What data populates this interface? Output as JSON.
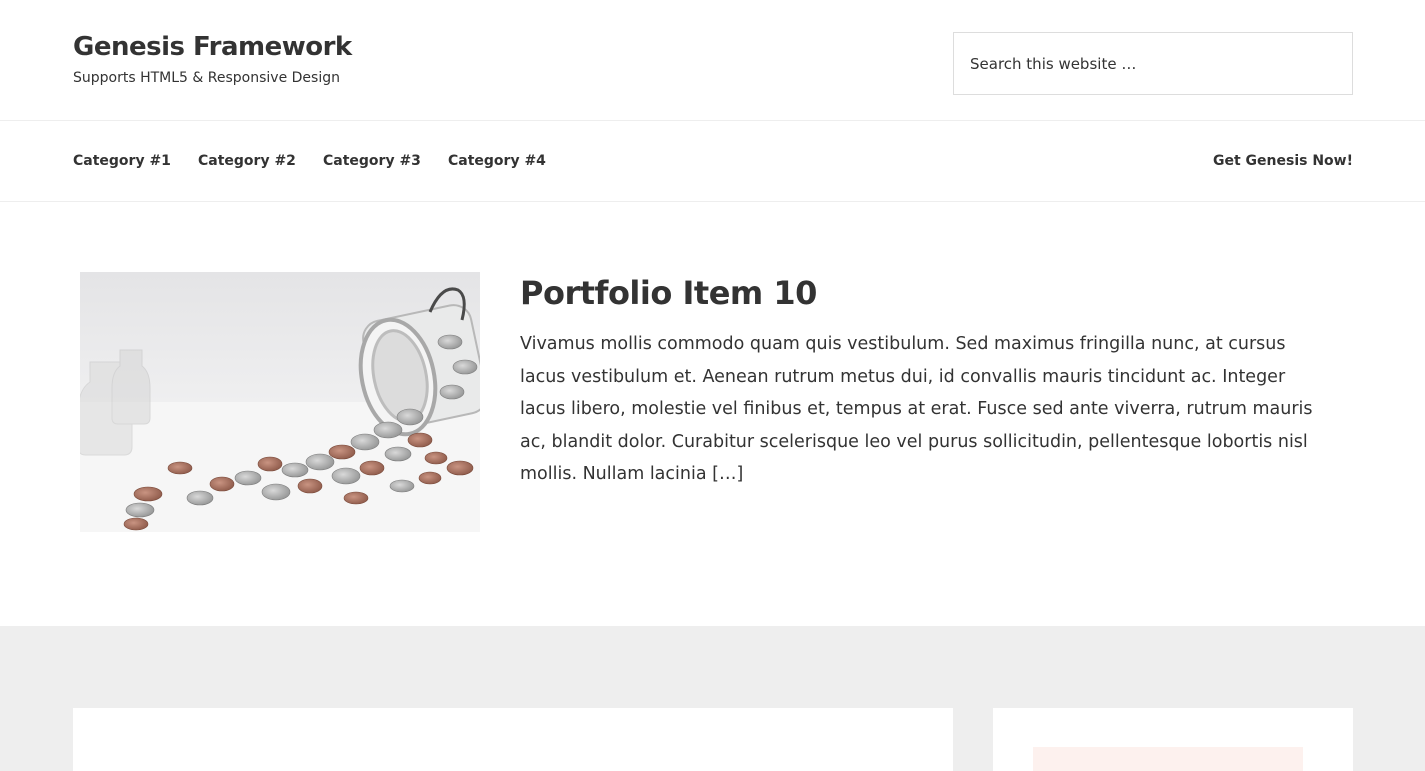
{
  "header": {
    "site_title": "Genesis Framework",
    "site_description": "Supports HTML5 & Responsive Design",
    "search_placeholder": "Search this website …"
  },
  "nav": {
    "items": [
      {
        "label": "Category #1"
      },
      {
        "label": "Category #2"
      },
      {
        "label": "Category #3"
      },
      {
        "label": "Category #4"
      }
    ],
    "cta_label": "Get Genesis Now!"
  },
  "entry": {
    "title": "Portfolio Item 10",
    "excerpt": "Vivamus mollis commodo quam quis vestibulum. Sed maximus fringilla nunc, at cursus lacus vestibulum et. Aenean rutrum metus dui, id convallis mauris tincidunt ac. Integer lacus libero, molestie vel finibus et, tempus at erat. Fusce sed ante viverra, rutrum mauris ac, blandit dolor. Curabitur scelerisque leo vel purus sollicitudin, pellentesque lobortis nisl mollis. Nullam lacinia […]",
    "image_icon": "coins-jar-photo"
  },
  "colors": {
    "text": "#333333",
    "border": "#eeeeee",
    "footer_bg": "#eeeeee",
    "page_bg": "#ffffff"
  }
}
